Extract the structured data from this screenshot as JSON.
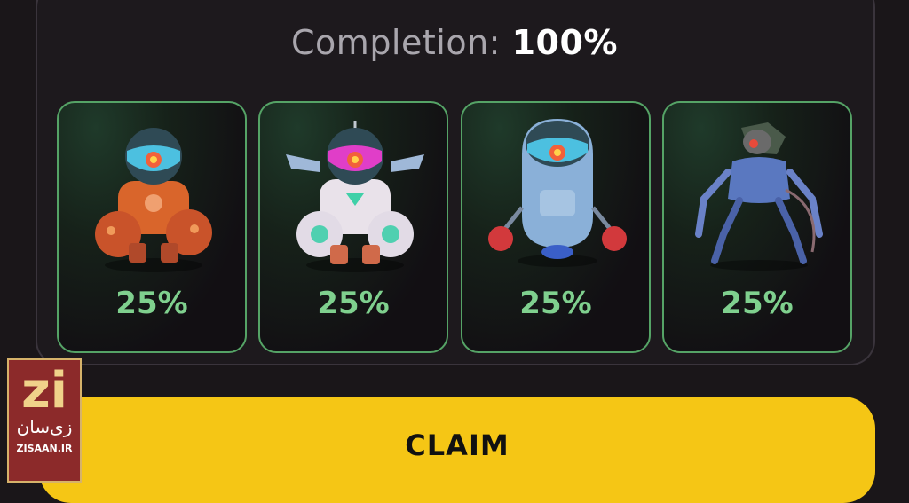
{
  "header": {
    "completion_label": "Completion:",
    "completion_value": "100%"
  },
  "cards": [
    {
      "name": "orange-robot",
      "percent": "25%"
    },
    {
      "name": "white-pink-robot",
      "percent": "25%"
    },
    {
      "name": "boxer-robot",
      "percent": "25%"
    },
    {
      "name": "cyborg-rat",
      "percent": "25%"
    }
  ],
  "claim_label": "CLAIM",
  "watermark": {
    "logo": "zi",
    "fa_text": "زی‌سان",
    "en_text": "ZISAAN.IR"
  },
  "colors": {
    "background": "#1a1619",
    "card_border": "#55a366",
    "percent_text": "#7fd08e",
    "claim_button": "#f5c615"
  }
}
